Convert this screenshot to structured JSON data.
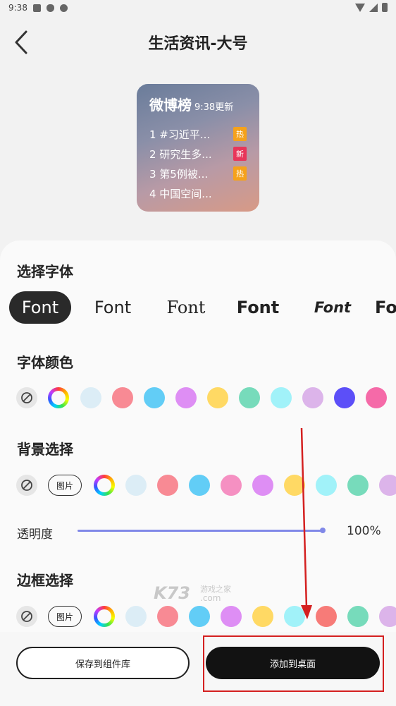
{
  "status_bar": {
    "time": "9:38"
  },
  "header": {
    "title": "生活资讯-大号"
  },
  "widget": {
    "title": "微博榜",
    "update": "9:38更新",
    "rows": [
      {
        "text": "1 #习近平...",
        "tag": "热",
        "tag_type": "hot"
      },
      {
        "text": "2 研究生多...",
        "tag": "新",
        "tag_type": "new"
      },
      {
        "text": "3 第5例被...",
        "tag": "热",
        "tag_type": "hot"
      },
      {
        "text": "4 中国空间...",
        "tag": "",
        "tag_type": ""
      }
    ]
  },
  "font_section": {
    "title": "选择字体",
    "items": [
      "Font",
      "Font",
      "Font",
      "Font",
      "Font",
      "Fo"
    ]
  },
  "font_color_section": {
    "title": "字体颜色",
    "colors": [
      "#dcedf6",
      "#f88a94",
      "#62cdf6",
      "#de8ef4",
      "#ffd964",
      "#77dbbb",
      "#a1f2f9",
      "#dcb4ea",
      "#5c4ff8",
      "#f56aa8"
    ]
  },
  "background_section": {
    "title": "背景选择",
    "image_label": "图片",
    "colors": [
      "#dcedf6",
      "#f88a94",
      "#62cdf6",
      "#f590c2",
      "#de8ef4",
      "#ffd964",
      "#a1f2f9",
      "#77dbbb",
      "#dcb4ea"
    ]
  },
  "opacity": {
    "label": "透明度",
    "value_text": "100%"
  },
  "border_section": {
    "title": "边框选择",
    "image_label": "图片",
    "colors": [
      "#dcedf6",
      "#f88a94",
      "#62cdf6",
      "#de8ef4",
      "#ffd964",
      "#a1f2f9",
      "#f77b78",
      "#77dbbb",
      "#dcb4ea"
    ]
  },
  "actions": {
    "save_label": "保存到组件库",
    "add_label": "添加到桌面"
  },
  "watermark": {
    "logo": "K73",
    "site_cn": "游戏之家",
    "site_en": ".com"
  },
  "colors": {
    "accent_slider": "#8088e8",
    "highlight_red": "#d42020",
    "primary_button": "#121212"
  }
}
